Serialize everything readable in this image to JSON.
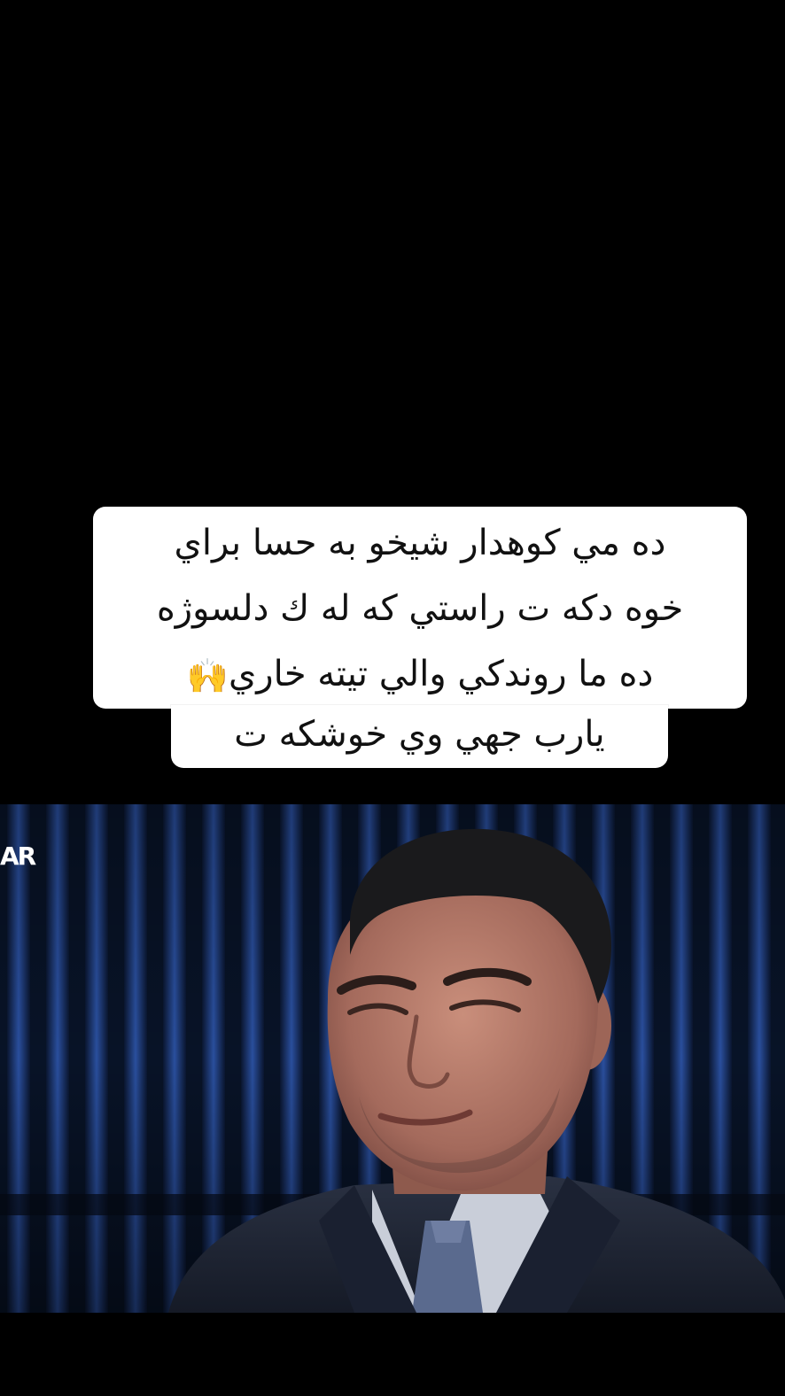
{
  "caption": {
    "lines": [
      "ده مي كوهدار شيخو به حسا براي",
      "خوه دكه ت راستي كه له ك دلسوژه",
      "ده ما روندكي والي تيته خاري",
      "يارب جهي وي خوشكه ت"
    ],
    "emoji": "🙌"
  },
  "video": {
    "channel_logo": "AR",
    "subject": "man in dark suit and tie, tearful expression, in front of blue striped studio backdrop"
  },
  "colors": {
    "background": "#000000",
    "caption_bg": "#ffffff",
    "caption_text": "#111111",
    "backdrop_stripe": "#1f3f86",
    "backdrop_dark": "#081327",
    "suit": "#1d2434",
    "skin": "#b5786a"
  }
}
